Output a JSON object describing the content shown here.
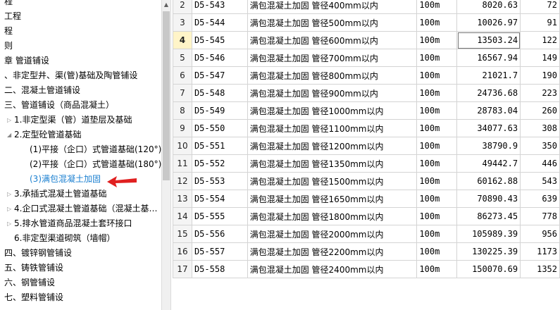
{
  "tree": {
    "items": [
      {
        "text": "程",
        "indent": 0,
        "toggle": ""
      },
      {
        "text": "工程",
        "indent": 0,
        "toggle": ""
      },
      {
        "text": "程",
        "indent": 0,
        "toggle": ""
      },
      {
        "text": "则",
        "indent": 0,
        "toggle": ""
      },
      {
        "text": "章 管道铺设",
        "indent": 0,
        "toggle": ""
      },
      {
        "text": "、非定型井、渠(管)基础及陶管铺设",
        "indent": 0,
        "toggle": ""
      },
      {
        "text": "二、混凝土管道铺设",
        "indent": 0,
        "toggle": ""
      },
      {
        "text": "三、管道铺设（商品混凝土）",
        "indent": 0,
        "toggle": ""
      },
      {
        "text": "1.非定型渠（管）道垫层及基础",
        "indent": 1,
        "toggle": "▷"
      },
      {
        "text": "2.定型砼管道基础",
        "indent": 1,
        "toggle": "◢"
      },
      {
        "text": "(1)平接（企口）式管道基础(120°)",
        "indent": 2,
        "toggle": ""
      },
      {
        "text": "(2)平接（企口）式管道基础(180°)",
        "indent": 2,
        "toggle": ""
      },
      {
        "text": "(3)满包混凝土加固",
        "indent": 2,
        "toggle": "",
        "selected": true
      },
      {
        "text": "3.承插式混凝土管道基础",
        "indent": 1,
        "toggle": "▷"
      },
      {
        "text": "4.企口式混凝土管道基础（混凝土基…",
        "indent": 1,
        "toggle": "▷"
      },
      {
        "text": "5.排水管道商品混凝土套环接口",
        "indent": 1,
        "toggle": "▷"
      },
      {
        "text": "6.非定型渠道砌筑（墙帽）",
        "indent": 1,
        "toggle": ""
      },
      {
        "text": "四、镀锌钢管铺设",
        "indent": 0,
        "toggle": ""
      },
      {
        "text": "五、铸铁管铺设",
        "indent": 0,
        "toggle": ""
      },
      {
        "text": "六、钢管铺设",
        "indent": 0,
        "toggle": ""
      },
      {
        "text": "七、塑料管铺设",
        "indent": 0,
        "toggle": ""
      }
    ]
  },
  "grid": {
    "rows": [
      {
        "n": "2",
        "code": "D5-543",
        "name": "满包混凝土加固 管径400mm以内",
        "unit": "100m",
        "price": "8020.63",
        "extra": "72"
      },
      {
        "n": "3",
        "code": "D5-544",
        "name": "满包混凝土加固 管径500mm以内",
        "unit": "100m",
        "price": "10026.97",
        "extra": "91"
      },
      {
        "n": "4",
        "code": "D5-545",
        "name": "满包混凝土加固 管径600mm以内",
        "unit": "100m",
        "price": "13503.24",
        "extra": "122",
        "active": true
      },
      {
        "n": "5",
        "code": "D5-546",
        "name": "满包混凝土加固 管径700mm以内",
        "unit": "100m",
        "price": "16567.94",
        "extra": "149"
      },
      {
        "n": "6",
        "code": "D5-547",
        "name": "满包混凝土加固 管径800mm以内",
        "unit": "100m",
        "price": "21021.7",
        "extra": "190"
      },
      {
        "n": "7",
        "code": "D5-548",
        "name": "满包混凝土加固 管径900mm以内",
        "unit": "100m",
        "price": "24736.68",
        "extra": "223"
      },
      {
        "n": "8",
        "code": "D5-549",
        "name": "满包混凝土加固 管径1000mm以内",
        "unit": "100m",
        "price": "28783.04",
        "extra": "260"
      },
      {
        "n": "9",
        "code": "D5-550",
        "name": "满包混凝土加固 管径1100mm以内",
        "unit": "100m",
        "price": "34077.63",
        "extra": "308"
      },
      {
        "n": "10",
        "code": "D5-551",
        "name": "满包混凝土加固 管径1200mm以内",
        "unit": "100m",
        "price": "38790.9",
        "extra": "350"
      },
      {
        "n": "11",
        "code": "D5-552",
        "name": "满包混凝土加固 管径1350mm以内",
        "unit": "100m",
        "price": "49442.7",
        "extra": "446"
      },
      {
        "n": "12",
        "code": "D5-553",
        "name": "满包混凝土加固 管径1500mm以内",
        "unit": "100m",
        "price": "60162.88",
        "extra": "543"
      },
      {
        "n": "13",
        "code": "D5-554",
        "name": "满包混凝土加固 管径1650mm以内",
        "unit": "100m",
        "price": "70890.43",
        "extra": "639"
      },
      {
        "n": "14",
        "code": "D5-555",
        "name": "满包混凝土加固 管径1800mm以内",
        "unit": "100m",
        "price": "86273.45",
        "extra": "778"
      },
      {
        "n": "15",
        "code": "D5-556",
        "name": "满包混凝土加固 管径2000mm以内",
        "unit": "100m",
        "price": "105989.39",
        "extra": "956"
      },
      {
        "n": "16",
        "code": "D5-557",
        "name": "满包混凝土加固 管径2200mm以内",
        "unit": "100m",
        "price": "130225.39",
        "extra": "1173"
      },
      {
        "n": "17",
        "code": "D5-558",
        "name": "满包混凝土加固 管径2400mm以内",
        "unit": "100m",
        "price": "150070.69",
        "extra": "1352"
      }
    ]
  },
  "colors": {
    "selected_text": "#1a7fd0",
    "annotation_arrow": "#e02020",
    "active_row_header": "#fff4c8"
  },
  "icons": {
    "collapsed": "triangle-right-icon",
    "expanded": "triangle-down-icon"
  }
}
